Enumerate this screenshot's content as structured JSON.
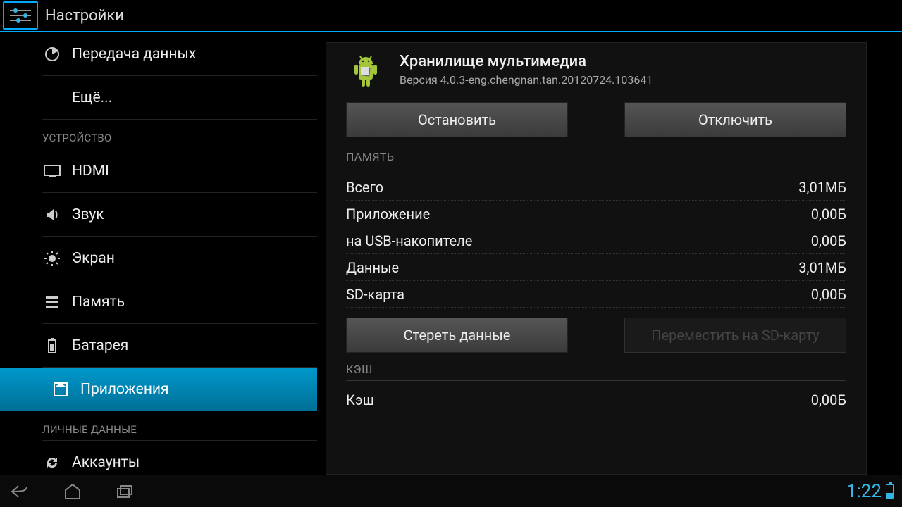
{
  "header": {
    "title": "Настройки"
  },
  "sidebar": {
    "items": [
      {
        "label": "Передача данных"
      },
      {
        "label": "Ещё..."
      }
    ],
    "device_header": "УСТРОЙСТВО",
    "device_items": [
      {
        "label": "HDMI"
      },
      {
        "label": "Звук"
      },
      {
        "label": "Экран"
      },
      {
        "label": "Память"
      },
      {
        "label": "Батарея"
      },
      {
        "label": "Приложения"
      }
    ],
    "personal_header": "ЛИЧНЫЕ ДАННЫЕ",
    "personal_items": [
      {
        "label": "Аккаунты"
      }
    ]
  },
  "detail": {
    "app_name": "Хранилище мультимедиа",
    "version_prefix": "Версия ",
    "version": "4.0.3-eng.chengnan.tan.20120724.103641",
    "btn_stop": "Остановить",
    "btn_disable": "Отключить",
    "section_memory": "ПАМЯТЬ",
    "memory_rows": [
      {
        "label": "Всего",
        "value": "3,01МБ"
      },
      {
        "label": "Приложение",
        "value": "0,00Б"
      },
      {
        "label": "на USB-накопителе",
        "value": "0,00Б"
      },
      {
        "label": "Данные",
        "value": "3,01МБ"
      },
      {
        "label": "SD-карта",
        "value": "0,00Б"
      }
    ],
    "btn_clear_data": "Стереть данные",
    "btn_move_sd": "Переместить на SD-карту",
    "section_cache": "КЭШ",
    "cache_row": {
      "label": "Кэш",
      "value": "0,00Б"
    }
  },
  "navbar": {
    "clock": "1:22"
  }
}
